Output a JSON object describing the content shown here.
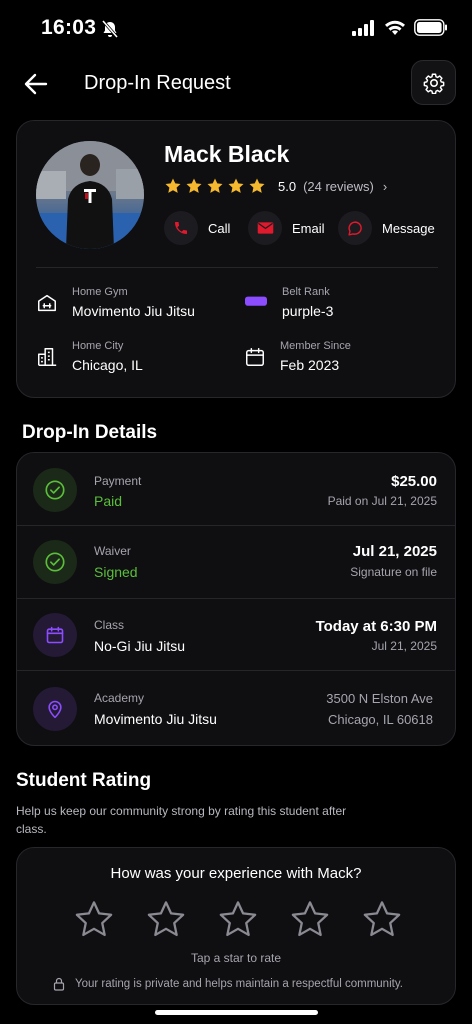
{
  "status_bar": {
    "time": "16:03"
  },
  "header": {
    "title": "Drop-In Request"
  },
  "profile": {
    "name": "Mack Black",
    "rating_score": "5.0",
    "rating_reviews": "(24 reviews)",
    "actions": {
      "call": "Call",
      "email": "Email",
      "message": "Message"
    },
    "home_gym_label": "Home Gym",
    "home_gym": "Movimento Jiu Jitsu",
    "belt_rank_label": "Belt Rank",
    "belt_rank": "purple-3",
    "home_city_label": "Home City",
    "home_city": "Chicago, IL",
    "member_since_label": "Member Since",
    "member_since": "Feb 2023"
  },
  "details": {
    "title": "Drop-In Details",
    "payment": {
      "label": "Payment",
      "value": "Paid",
      "amount": "$25.00",
      "sub": "Paid on Jul 21, 2025"
    },
    "waiver": {
      "label": "Waiver",
      "value": "Signed",
      "date": "Jul 21, 2025",
      "sub": "Signature on file"
    },
    "class": {
      "label": "Class",
      "value": "No-Gi Jiu Jitsu",
      "time": "Today at 6:30 PM",
      "sub": "Jul 21, 2025"
    },
    "academy": {
      "label": "Academy",
      "value": "Movimento Jiu Jitsu",
      "address1": "3500 N Elston Ave",
      "address2": "Chicago, IL 60618"
    }
  },
  "student_rating": {
    "title": "Student Rating",
    "description": "Help us keep our community strong by rating this student after class.",
    "question": "How was your experience with Mack?",
    "hint": "Tap a star to rate",
    "privacy": "Your rating is private and helps maintain a respectful community."
  },
  "colors": {
    "accent_red": "#e0192d",
    "star_gold": "#f5b82e",
    "green": "#5bbf3a",
    "purple": "#8b4dff"
  }
}
